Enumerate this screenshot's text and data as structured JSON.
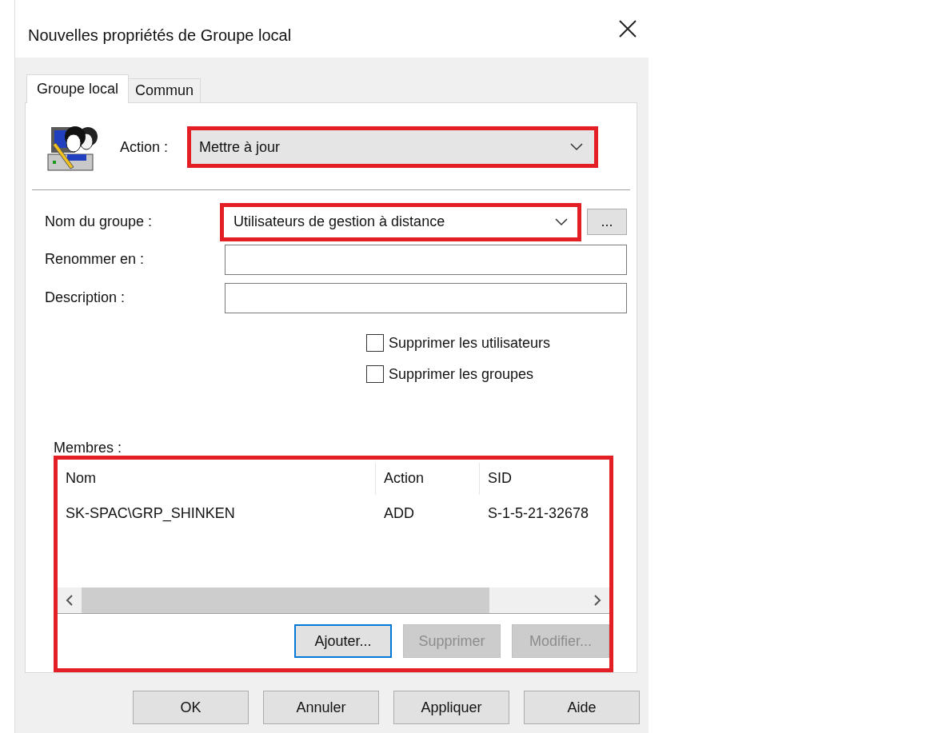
{
  "window": {
    "title": "Nouvelles propriétés de Groupe local"
  },
  "tabs": [
    {
      "label": "Groupe local",
      "selected": true
    },
    {
      "label": "Commun",
      "selected": false
    }
  ],
  "action": {
    "label": "Action :",
    "value": "Mettre à jour",
    "highlighted": true
  },
  "group_name": {
    "label": "Nom du groupe :",
    "value": "Utilisateurs de gestion à distance",
    "highlighted": true,
    "browse_button": "..."
  },
  "rename": {
    "label": "Renommer en :"
  },
  "description": {
    "label": "Description :"
  },
  "checkboxes": [
    {
      "label": "Supprimer les utilisateurs",
      "checked": false
    },
    {
      "label": "Supprimer les groupes",
      "checked": false
    }
  ],
  "members": {
    "label": "Membres :",
    "highlighted": true,
    "columns": [
      "Nom",
      "Action",
      "SID"
    ],
    "rows": [
      [
        "SK-SPAC\\GRP_SHINKEN",
        "ADD",
        "S-1-5-21-32678"
      ]
    ],
    "buttons": [
      {
        "label": "Ajouter...",
        "disabled": false,
        "focused": true
      },
      {
        "label": "Supprimer",
        "disabled": true,
        "focused": false
      },
      {
        "label": "Modifier...",
        "disabled": true,
        "focused": false
      }
    ]
  },
  "buttons": [
    "OK",
    "Annuler",
    "Appliquer",
    "Aide"
  ]
}
